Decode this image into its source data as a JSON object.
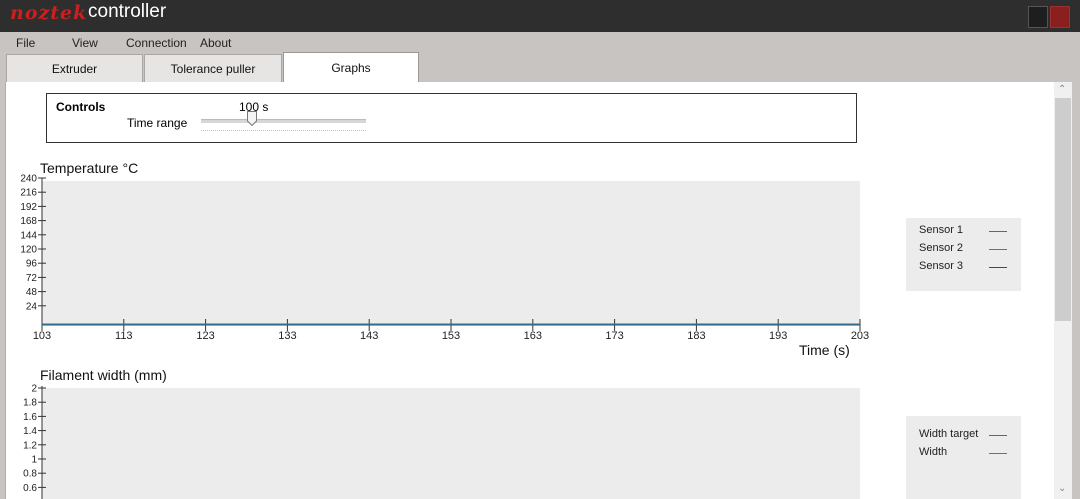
{
  "window": {
    "brand": "noztek",
    "title": "controller",
    "brand_color": "#cc1f1f",
    "close_color": "#8b1e1e"
  },
  "menu": [
    "File",
    "View",
    "Connection",
    "About"
  ],
  "tabs": [
    {
      "label": "Extruder",
      "active": false
    },
    {
      "label": "Tolerance puller",
      "active": false
    },
    {
      "label": "Graphs",
      "active": true
    }
  ],
  "controls": {
    "title": "Controls",
    "time_range_label": "Time range",
    "time_range_value": "100 s"
  },
  "chart_data": [
    {
      "type": "line",
      "title": "Temperature °C",
      "xlabel": "Time (s)",
      "ylabel": "",
      "xlim": [
        103,
        203
      ],
      "ylim": [
        0,
        240
      ],
      "x_ticks": [
        "103",
        "113",
        "123",
        "133",
        "143",
        "153",
        "163",
        "173",
        "183",
        "193",
        "203"
      ],
      "y_ticks": [
        "240",
        "216",
        "192",
        "168",
        "144",
        "120",
        "96",
        "72",
        "48",
        "24"
      ],
      "series": [
        {
          "name": "Sensor 1",
          "color": "#e03030",
          "values": []
        },
        {
          "name": "Sensor 2",
          "color": "#2e9e2e",
          "values": []
        },
        {
          "name": "Sensor 3",
          "color": "#3535e0",
          "values": []
        }
      ],
      "legend": "right"
    },
    {
      "type": "line",
      "title": "Filament width (mm)",
      "xlabel": "",
      "ylabel": "",
      "y_ticks": [
        "2",
        "1.8",
        "1.6",
        "1.4",
        "1.2",
        "1",
        "0.8",
        "0.6"
      ],
      "series": [
        {
          "name": "Width target",
          "color": "#e03030",
          "values": []
        },
        {
          "name": "Width",
          "color": "#2e9e2e",
          "values": []
        }
      ],
      "legend": "right"
    }
  ]
}
